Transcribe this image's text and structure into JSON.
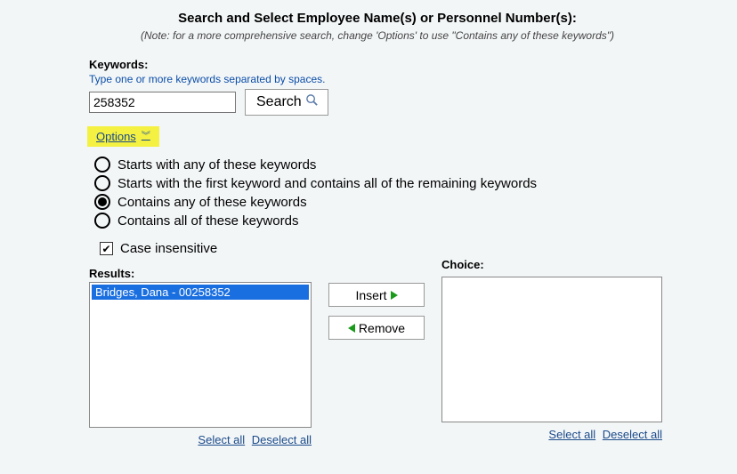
{
  "header": {
    "title": "Search and Select Employee Name(s) or Personnel Number(s):",
    "note": "(Note: for a more comprehensive search, change 'Options' to use \"Contains any of these keywords\")"
  },
  "keywords": {
    "label": "Keywords:",
    "hint": "Type one or more keywords separated by spaces.",
    "value": "258352",
    "search_label": "Search"
  },
  "options": {
    "toggle_label": "Options",
    "radios": [
      {
        "label": "Starts with any of these keywords",
        "selected": false
      },
      {
        "label": "Starts with the first keyword and contains all of the remaining keywords",
        "selected": false
      },
      {
        "label": "Contains any of these keywords",
        "selected": true
      },
      {
        "label": "Contains all of these keywords",
        "selected": false
      }
    ],
    "case_insensitive_label": "Case insensitive",
    "case_insensitive_checked": true
  },
  "transfer": {
    "results_label": "Results:",
    "choice_label": "Choice:",
    "insert_label": "Insert",
    "remove_label": "Remove",
    "select_all": "Select all",
    "deselect_all": "Deselect all",
    "results": [
      {
        "text": "Bridges, Dana - 00258352",
        "selected": true
      }
    ],
    "choices": []
  }
}
